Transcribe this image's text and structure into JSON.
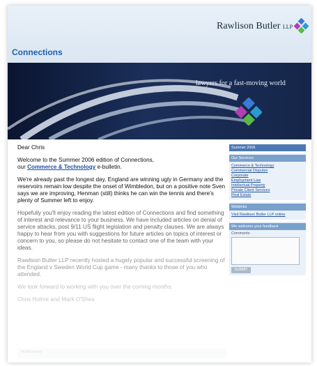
{
  "header": {
    "logo_text": "Rawlison Butler",
    "logo_suffix": "LLP",
    "section_title": "Connections"
  },
  "banner": {
    "tagline": "lawyers for a fast-moving world"
  },
  "main": {
    "greeting": "Dear Chris",
    "intro_prefix": "Welcome to the Summer 2006 edition of Connections,",
    "intro_our": "our ",
    "intro_link": "Commerce & Technology",
    "intro_suffix": " e-bulletin.",
    "para1": "We're already past the longest day, England are winning ugly in Germany and the reservoirs remain low despite the onset of Wimbledon, but on a positive note Sven says we are improving, Henman (still) thinks he can win the tennis and there's plenty of Summer left to enjoy.",
    "para2": "Hopefully you'll enjoy reading the latest edition of Connections and find something of interest and relevance to your business. We have included articles on denial of service attacks, post 9/11 US flight legislation and penalty clauses. We are always happy to hear from you with suggestions for future articles on topics of interest or concern to you, so please do not hesitate to contact one of the team with your ideas.",
    "para3": "Rawlison Butler LLP recently hosted a hugely popular and successful screening of the England v Sweden World Cup game - many thanks to those of you who attended.",
    "para4": "We look forward to working with you over the coming months.",
    "signoff": "Chris Holme and Mark O'Shea",
    "in_this_issue": "In this issue"
  },
  "sidebar": {
    "edition": "Summer 2006",
    "services_heading": "Our Services",
    "services": [
      "Commerce & Technology",
      "Commercial Disputes",
      "Corporate",
      "Employment Law",
      "Intellectual Property",
      "Private Client Services",
      "Real Estate"
    ],
    "weblinks_heading": "Weblinks",
    "weblink": "Visit Rawlison Butler LLP online",
    "feedback_heading": "We welcome your feedback",
    "comments_label": "Comments",
    "submit_label": "SUBMIT"
  }
}
